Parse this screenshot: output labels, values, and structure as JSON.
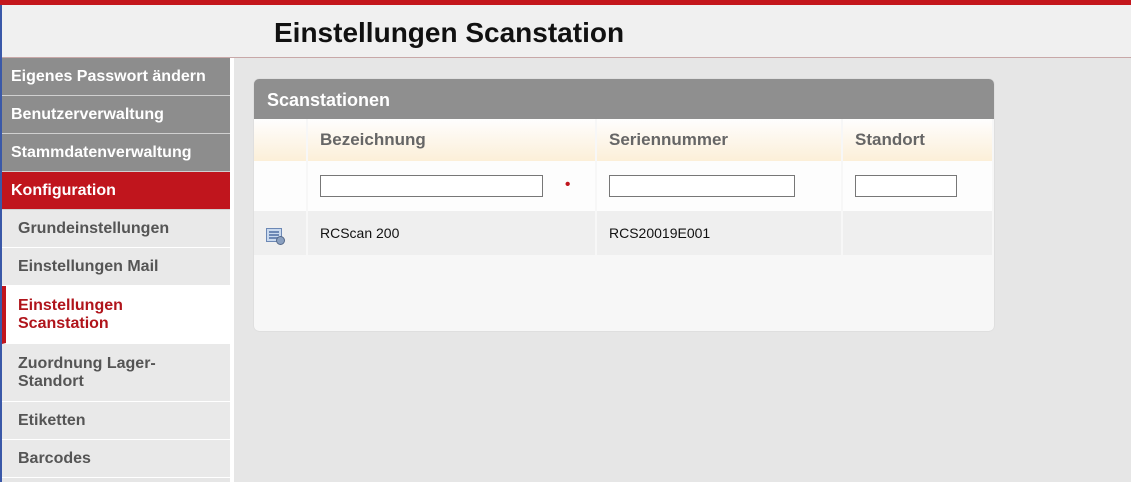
{
  "header": {
    "title": "Einstellungen Scanstation"
  },
  "sidebar": {
    "main": [
      {
        "label": "Eigenes Passwort ändern"
      },
      {
        "label": "Benutzerverwaltung"
      },
      {
        "label": "Stammdatenverwaltung"
      },
      {
        "label": "Konfiguration"
      }
    ],
    "sub": [
      {
        "label": "Grundeinstellungen"
      },
      {
        "label": "Einstellungen Mail"
      },
      {
        "label": "Einstellungen Scanstation"
      },
      {
        "label": "Zuordnung Lager-Standort"
      },
      {
        "label": "Etiketten"
      },
      {
        "label": "Barcodes"
      }
    ]
  },
  "panel": {
    "title": "Scanstationen",
    "columns": [
      "",
      "Bezeichnung",
      "Seriennummer",
      "Standort"
    ],
    "filters": {
      "bezeichnung": "",
      "seriennummer": "",
      "standort": "",
      "required_marker": "•"
    },
    "rows": [
      {
        "icon": "edit-scanstation-icon",
        "bezeichnung": "RCScan 200",
        "seriennummer": "RCS20019E001",
        "standort": ""
      }
    ]
  }
}
